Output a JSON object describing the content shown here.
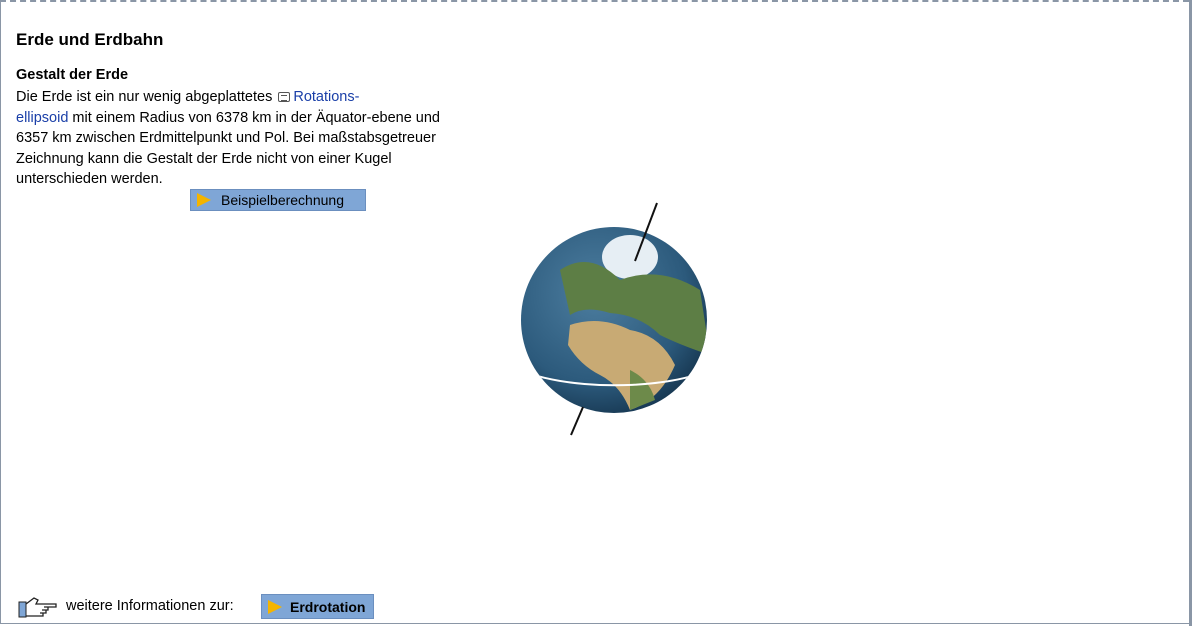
{
  "title": "Erde und Erdbahn",
  "section": {
    "heading": "Gestalt der Erde",
    "text_before": "Die Erde ist ein nur wenig abgeplattetes ",
    "link": "Rotations-ellipsoid",
    "link_part1": "Rotations-",
    "link_part2": "ellipsoid",
    "text_after": " mit einem Radius von 6378 km in der Äquator-ebene und 6357 km zwischen Erdmittelpunkt und Pol. Bei maßstabsgetreuer Zeichnung kann die Gestalt der Erde nicht von einer Kugel unterschieden werden.",
    "button": "Beispielberechnung"
  },
  "footer": {
    "text": "weitere Informationen zur:",
    "button": "Erdrotation"
  },
  "colors": {
    "button_bg": "#7fa6d6",
    "play": "#f4b400",
    "link": "#1a3fa8"
  }
}
